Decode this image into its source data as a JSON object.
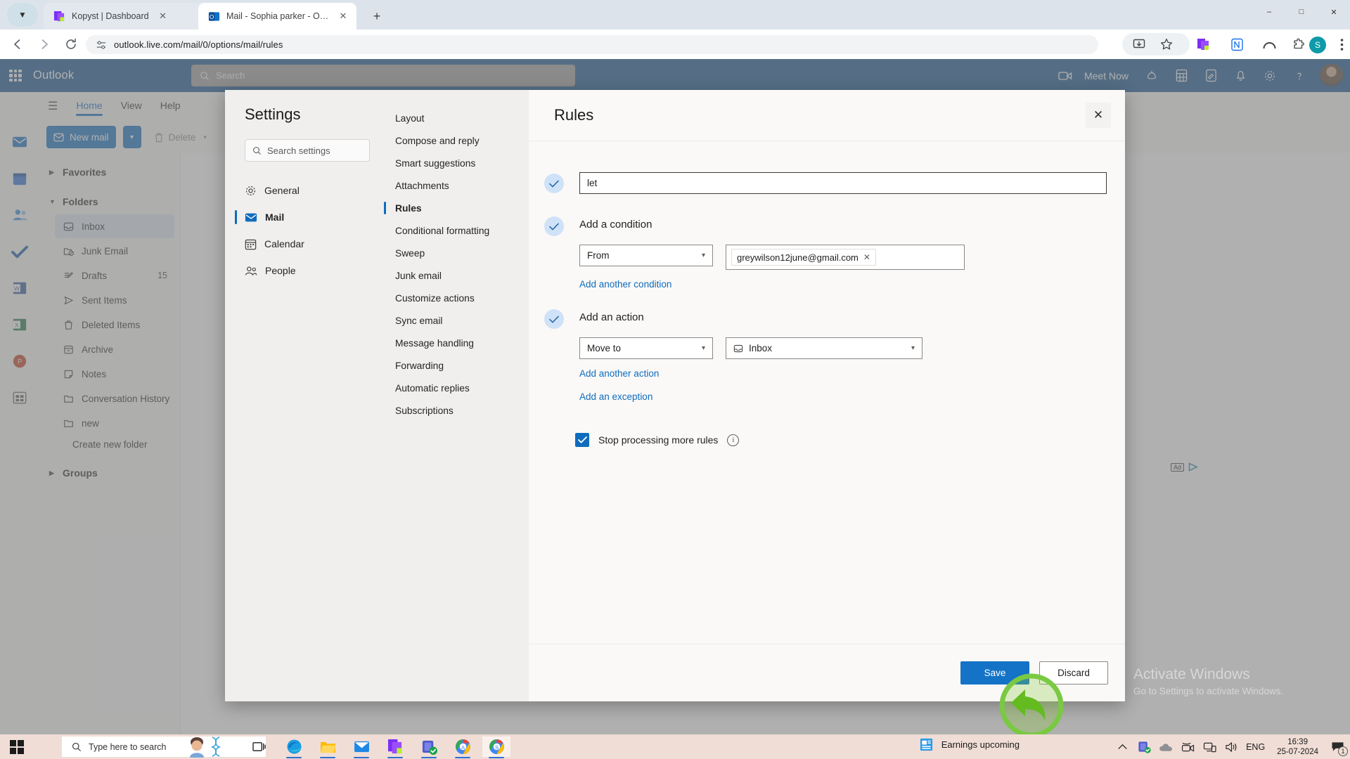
{
  "browser": {
    "tabs": [
      {
        "title": "Kopyst | Dashboard",
        "active": false,
        "favicon": "kopyst-icon"
      },
      {
        "title": "Mail - Sophia parker - Outlook",
        "active": true,
        "favicon": "outlook-icon"
      }
    ],
    "new_tab_label": "+",
    "url": "outlook.live.com/mail/0/options/mail/rules",
    "nav": {
      "back": "back-icon",
      "forward": "forward-icon",
      "reload": "reload-icon"
    },
    "profile_initial": "S",
    "window_controls": {
      "minimize": "–",
      "maximize": "□",
      "close": "✕"
    }
  },
  "outlook": {
    "brand": "Outlook",
    "search_placeholder": "Search",
    "meet_now": "Meet Now",
    "ribbon_tabs": [
      {
        "label": "Home",
        "active": true
      },
      {
        "label": "View",
        "active": false
      },
      {
        "label": "Help",
        "active": false
      }
    ],
    "commands": {
      "new_mail": "New mail",
      "delete": "Delete"
    },
    "folders": {
      "favorites_label": "Favorites",
      "folders_label": "Folders",
      "groups_label": "Groups",
      "create_new_folder": "Create new folder",
      "items": [
        {
          "label": "Inbox",
          "icon": "inbox-icon",
          "count": "",
          "selected": true
        },
        {
          "label": "Junk Email",
          "icon": "junk-icon",
          "count": "",
          "selected": false
        },
        {
          "label": "Drafts",
          "icon": "drafts-icon",
          "count": "15",
          "selected": false
        },
        {
          "label": "Sent Items",
          "icon": "sent-icon",
          "count": "",
          "selected": false
        },
        {
          "label": "Deleted Items",
          "icon": "trash-icon",
          "count": "",
          "selected": false
        },
        {
          "label": "Archive",
          "icon": "archive-icon",
          "count": "",
          "selected": false
        },
        {
          "label": "Notes",
          "icon": "notes-icon",
          "count": "",
          "selected": false
        },
        {
          "label": "Conversation History",
          "icon": "folder-icon",
          "count": "",
          "selected": false
        },
        {
          "label": "new",
          "icon": "folder-icon",
          "count": "",
          "selected": false
        }
      ]
    },
    "ad_label": "Ad"
  },
  "settings": {
    "title": "Settings",
    "search_placeholder": "Search settings",
    "nav": [
      {
        "label": "General",
        "icon": "gear-icon",
        "selected": false
      },
      {
        "label": "Mail",
        "icon": "mail-icon",
        "selected": true
      },
      {
        "label": "Calendar",
        "icon": "calendar-icon",
        "selected": false
      },
      {
        "label": "People",
        "icon": "people-icon",
        "selected": false
      }
    ],
    "sub_nav": [
      {
        "label": "Layout",
        "selected": false
      },
      {
        "label": "Compose and reply",
        "selected": false
      },
      {
        "label": "Smart suggestions",
        "selected": false
      },
      {
        "label": "Attachments",
        "selected": false
      },
      {
        "label": "Rules",
        "selected": true
      },
      {
        "label": "Conditional formatting",
        "selected": false
      },
      {
        "label": "Sweep",
        "selected": false
      },
      {
        "label": "Junk email",
        "selected": false
      },
      {
        "label": "Customize actions",
        "selected": false
      },
      {
        "label": "Sync email",
        "selected": false
      },
      {
        "label": "Message handling",
        "selected": false
      },
      {
        "label": "Forwarding",
        "selected": false
      },
      {
        "label": "Automatic replies",
        "selected": false
      },
      {
        "label": "Subscriptions",
        "selected": false
      }
    ],
    "panel": {
      "heading": "Rules",
      "close_icon": "close-icon",
      "rule_name_value": "let",
      "condition_section_label": "Add a condition",
      "condition_field": "From",
      "condition_token": "greywilson12june@gmail.com",
      "add_another_condition": "Add another condition",
      "action_section_label": "Add an action",
      "action_field": "Move to",
      "action_target": "Inbox",
      "add_another_action": "Add another action",
      "add_an_exception": "Add an exception",
      "stop_processing_label": "Stop processing more rules",
      "stop_processing_checked": true,
      "info_icon": "info-icon",
      "save_label": "Save",
      "discard_label": "Discard",
      "accent_color": "#0f6cbd",
      "save_button_color": "#1473c6"
    }
  },
  "watermark": {
    "line1": "Activate Windows",
    "line2": "Go to Settings to activate Windows."
  },
  "taskbar": {
    "search_placeholder": "Type here to search",
    "news_label": "Earnings upcoming",
    "language": "ENG",
    "time": "16:39",
    "date": "25-07-2024",
    "notification_count": "1",
    "apps": [
      {
        "name": "task-view-icon"
      },
      {
        "name": "edge-icon"
      },
      {
        "name": "file-explorer-icon"
      },
      {
        "name": "mail-icon"
      },
      {
        "name": "kopyst-icon"
      },
      {
        "name": "teams-icon"
      },
      {
        "name": "chrome-a-icon"
      },
      {
        "name": "chrome-s-icon"
      }
    ]
  }
}
